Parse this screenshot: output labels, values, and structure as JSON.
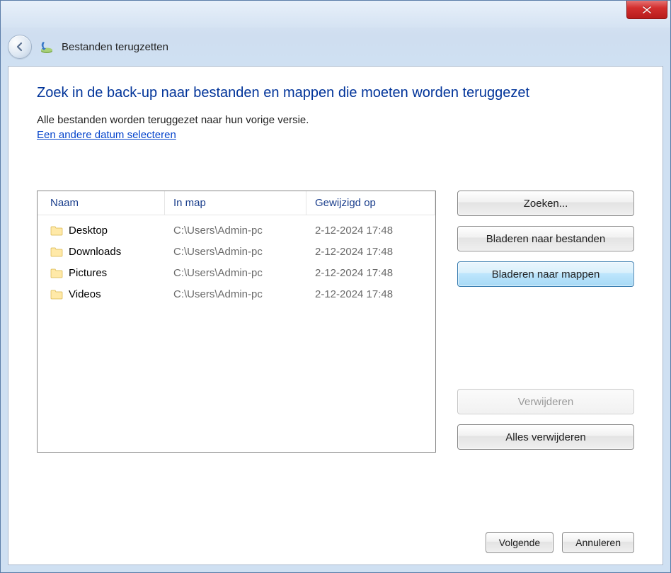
{
  "window": {
    "title": "Bestanden terugzetten"
  },
  "page": {
    "heading": "Zoek in de back-up naar bestanden en mappen die moeten worden teruggezet",
    "subtext": "Alle bestanden worden teruggezet naar hun vorige versie.",
    "link": "Een andere datum selecteren"
  },
  "columns": {
    "name": "Naam",
    "folder": "In map",
    "modified": "Gewijzigd op"
  },
  "items": [
    {
      "name": "Desktop",
      "folder": "C:\\Users\\Admin-pc",
      "modified": "2-12-2024 17:48"
    },
    {
      "name": "Downloads",
      "folder": "C:\\Users\\Admin-pc",
      "modified": "2-12-2024 17:48"
    },
    {
      "name": "Pictures",
      "folder": "C:\\Users\\Admin-pc",
      "modified": "2-12-2024 17:48"
    },
    {
      "name": "Videos",
      "folder": "C:\\Users\\Admin-pc",
      "modified": "2-12-2024 17:48"
    }
  ],
  "buttons": {
    "search": "Zoeken...",
    "browse_files": "Bladeren naar bestanden",
    "browse_folders": "Bladeren naar mappen",
    "remove": "Verwijderen",
    "remove_all": "Alles verwijderen",
    "next": "Volgende",
    "cancel": "Annuleren"
  }
}
